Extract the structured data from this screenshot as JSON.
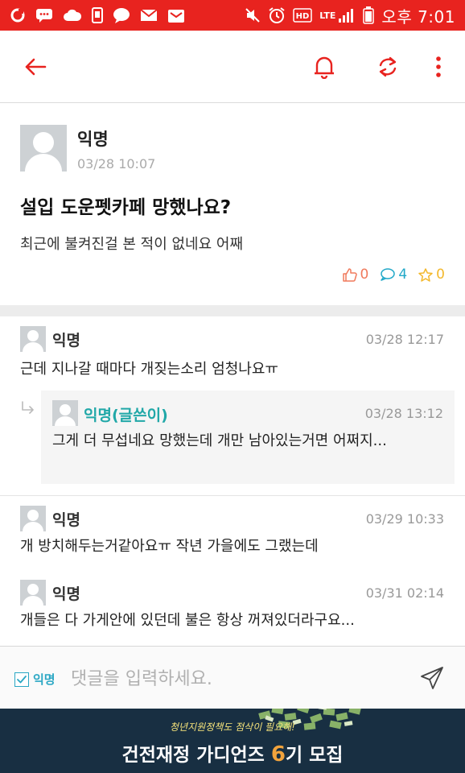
{
  "status_bar": {
    "network": "LTE",
    "time": "오후 7:01",
    "hd_label": "HD"
  },
  "toolbar": {
    "back_icon": "arrow-left-icon",
    "bell_icon": "bell-icon",
    "refresh_icon": "refresh-icon",
    "more_icon": "more-vertical-icon",
    "accent_color": "#e8231f"
  },
  "post": {
    "author": "익명",
    "time": "03/28 10:07",
    "title": "설입 도운펫카페 망했나요?",
    "body": "최근에 불켜진걸 본 적이 없네요 어째",
    "likes": "0",
    "comments": "4",
    "scraps": "0"
  },
  "comments": [
    {
      "author": "익명",
      "time": "03/28 12:17",
      "text": "근데 지나갈 때마다 개짖는소리 엄청나요ㅠ"
    },
    {
      "author": "익명(글쓴이)",
      "time": "03/28 13:12",
      "text": "그게 더 무섭네요 망했는데 개만 남아있는거면 어쩌지...",
      "is_reply": true
    },
    {
      "author": "익명",
      "time": "03/29 10:33",
      "text": "개 방치해두는거같아요ㅠ 작년 가을에도 그랬는데"
    },
    {
      "author": "익명",
      "time": "03/31 02:14",
      "text": "개들은 다 가게안에 있던데 불은 항상 꺼져있더라구요..."
    }
  ],
  "comment_input": {
    "anon_label": "익명",
    "anon_checked": true,
    "placeholder": "댓글을 입력하세요.",
    "value": ""
  },
  "banner": {
    "top_text": "청년지원정책도 점삭이 필요해!",
    "main_before": "건전재정 가디언즈 ",
    "main_number": "6",
    "main_after": "기 모집"
  }
}
